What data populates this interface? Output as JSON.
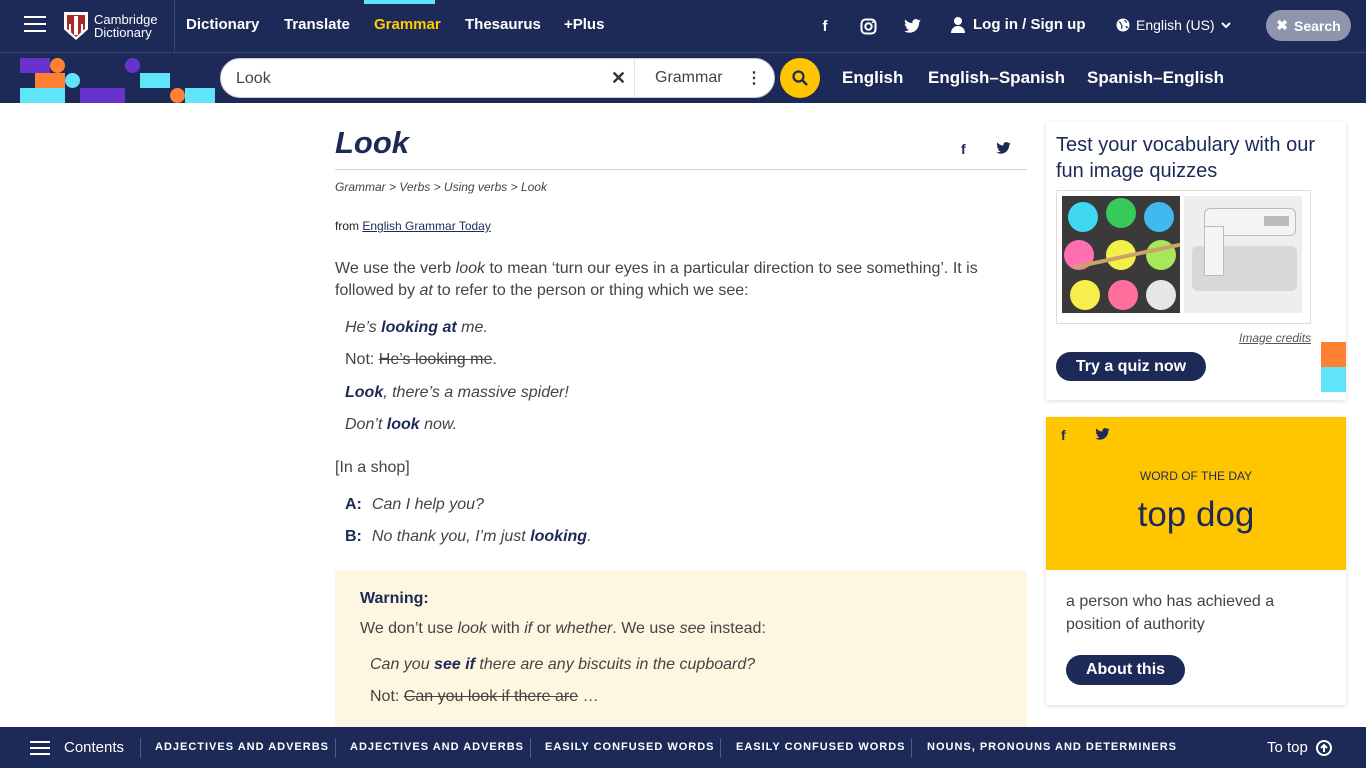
{
  "header": {
    "brand_line1": "Cambridge",
    "brand_line2": "Dictionary",
    "nav": [
      "Dictionary",
      "Translate",
      "Grammar",
      "Thesaurus",
      "+Plus"
    ],
    "login": "Log in / Sign up",
    "language": "English (US)",
    "search_label": "Search",
    "social_icons": [
      "facebook-icon",
      "instagram-icon",
      "twitter-icon"
    ]
  },
  "searchbar": {
    "query": "Look",
    "dictionary": "Grammar",
    "dict_links": [
      "English",
      "English–Spanish",
      "Spanish–English"
    ]
  },
  "article": {
    "title": "Look",
    "breadcrumb": "Grammar > Verbs > Using verbs > Look",
    "from_prefix": "from",
    "from_source": "English Grammar Today",
    "intro_1": "We use the verb ",
    "intro_look": "look",
    "intro_2": " to mean ‘turn our eyes in a particular direction to see something’. It is followed by ",
    "intro_at": "at",
    "intro_3": " to refer to the person or thing which we see:",
    "ex1_a": "He’s ",
    "ex1_b": "looking at",
    "ex1_c": " me.",
    "ex2_not": "Not: ",
    "ex2_struck": "He’s looking me",
    "ex2_end": ".",
    "ex3_a": "Look",
    "ex3_b": ", there’s a massive spider!",
    "ex4_a": "Don’t ",
    "ex4_b": "look",
    "ex4_c": " now.",
    "context": "[In a shop]",
    "dialog": [
      {
        "speaker": "A:",
        "line_a": "Can I help you?",
        "line_b": "",
        "line_c": ""
      },
      {
        "speaker": "B:",
        "line_a": "No thank you, I’m just ",
        "line_b": "looking",
        "line_c": "."
      }
    ],
    "warning_title": "Warning:",
    "warn_1": "We don’t use ",
    "warn_look": "look",
    "warn_2": " with ",
    "warn_if": "if",
    "warn_3": " or ",
    "warn_whether": "whether",
    "warn_4": ". We use ",
    "warn_see": "see",
    "warn_5": " instead:",
    "wex1_a": "Can you ",
    "wex1_b": "see if",
    "wex1_c": " there are any biscuits in the cupboard?",
    "wex2_not": "Not: ",
    "wex2_struck": "Can you look if there are",
    "wex2_end": " …"
  },
  "quiz": {
    "title": "Test your vocabulary with our fun image quizzes",
    "credits": "Image credits",
    "button": "Try a quiz now"
  },
  "wotd": {
    "label": "WORD OF THE DAY",
    "word": "top dog",
    "definition": "a person who has achieved a position of authority",
    "button": "About this"
  },
  "bottom": {
    "contents": "Contents",
    "links": [
      "ADJECTIVES AND ADVERBS",
      "ADJECTIVES AND ADVERBS",
      "EASILY CONFUSED WORDS",
      "EASILY CONFUSED WORDS",
      "NOUNS, PRONOUNS AND DETERMINERS"
    ],
    "to_top": "To top"
  },
  "colors": {
    "navy": "#1d2a57",
    "yellow": "#ffc600",
    "cyan": "#5fe4f9",
    "orange": "#fe8133",
    "purple": "#6833cc",
    "warning_bg": "#fdf6e1"
  }
}
